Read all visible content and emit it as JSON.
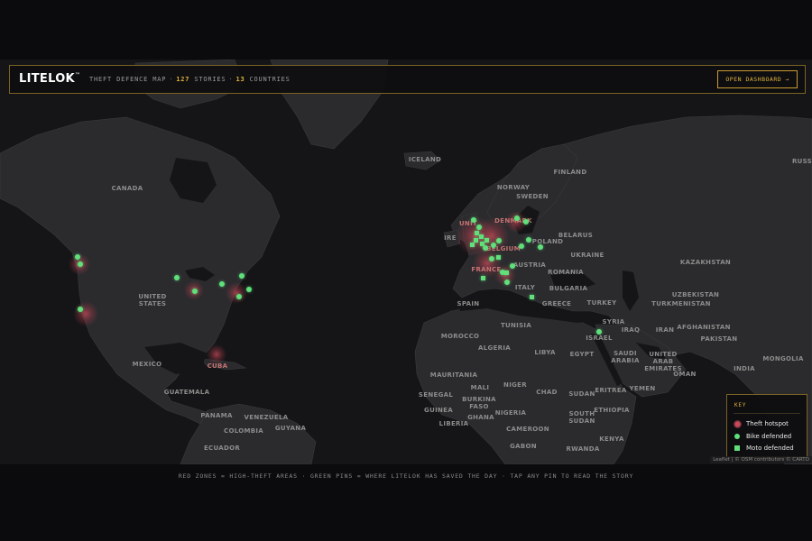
{
  "header": {
    "logo": "LITELOK",
    "logo_mark": "™",
    "subtitle_prefix": "THEFT DEFENCE MAP",
    "stories_count": "127",
    "stories_label": "STORIES",
    "countries_count": "13",
    "countries_label": "COUNTRIES",
    "dashboard_button": "OPEN DASHBOARD →"
  },
  "map": {
    "labels": [
      {
        "id": "iceland",
        "text": "ICELAND"
      },
      {
        "id": "canada",
        "text": "CANADA"
      },
      {
        "id": "usa",
        "text": "UNITED\nSTATES"
      },
      {
        "id": "mexico",
        "text": "MEXICO"
      },
      {
        "id": "cuba",
        "text": "CUBA"
      },
      {
        "id": "guatemala",
        "text": "GUATEMALA"
      },
      {
        "id": "panama",
        "text": "PANAMA"
      },
      {
        "id": "venezuela",
        "text": "VENEZUELA"
      },
      {
        "id": "guyana",
        "text": "GUYANA"
      },
      {
        "id": "colombia",
        "text": "COLOMBIA"
      },
      {
        "id": "ecuador",
        "text": "ECUADOR"
      },
      {
        "id": "finland",
        "text": "FINLAND"
      },
      {
        "id": "norway",
        "text": "NORWAY"
      },
      {
        "id": "sweden",
        "text": "SWEDEN"
      },
      {
        "id": "denmark",
        "text": "DENMARK"
      },
      {
        "id": "belarus",
        "text": "BELARUS"
      },
      {
        "id": "poland",
        "text": "POLAND"
      },
      {
        "id": "ukraine",
        "text": "UKRAINE"
      },
      {
        "id": "austria",
        "text": "AUSTRIA"
      },
      {
        "id": "romania",
        "text": "ROMANIA"
      },
      {
        "id": "bulgaria",
        "text": "BULGARIA"
      },
      {
        "id": "italy",
        "text": "ITALY"
      },
      {
        "id": "greece",
        "text": "GREECE"
      },
      {
        "id": "france",
        "text": "FRANCE"
      },
      {
        "id": "belgium",
        "text": "BELGIUM"
      },
      {
        "id": "ireland",
        "text": "IRE"
      },
      {
        "id": "uk",
        "text": "UNIT"
      },
      {
        "id": "spain",
        "text": "SPAIN"
      },
      {
        "id": "turkey",
        "text": "TURKEY"
      },
      {
        "id": "syria",
        "text": "SYRIA"
      },
      {
        "id": "iraq",
        "text": "IRAQ"
      },
      {
        "id": "iran",
        "text": "IRAN"
      },
      {
        "id": "israel",
        "text": "ISRAEL"
      },
      {
        "id": "tunisia",
        "text": "TUNISIA"
      },
      {
        "id": "morocco",
        "text": "MOROCCO"
      },
      {
        "id": "algeria",
        "text": "ALGERIA"
      },
      {
        "id": "libya",
        "text": "LIBYA"
      },
      {
        "id": "egypt",
        "text": "EGYPT"
      },
      {
        "id": "saudi",
        "text": "SAUDI\nARABIA"
      },
      {
        "id": "uae",
        "text": "UNITED\nARAB\nEMIRATES"
      },
      {
        "id": "oman",
        "text": "OMAN"
      },
      {
        "id": "yemen",
        "text": "YEMEN"
      },
      {
        "id": "eritrea",
        "text": "ERITREA"
      },
      {
        "id": "sudan",
        "text": "SUDAN"
      },
      {
        "id": "ssudan",
        "text": "SOUTH\nSUDAN"
      },
      {
        "id": "ethiopia",
        "text": "ETHIOPIA"
      },
      {
        "id": "kenya",
        "text": "KENYA"
      },
      {
        "id": "chad",
        "text": "CHAD"
      },
      {
        "id": "niger",
        "text": "NIGER"
      },
      {
        "id": "mali",
        "text": "MALI"
      },
      {
        "id": "mauritania",
        "text": "MAURITANIA"
      },
      {
        "id": "senegal",
        "text": "SENEGAL"
      },
      {
        "id": "guinea",
        "text": "GUINEA"
      },
      {
        "id": "burkina",
        "text": "BURKINA\nFASO"
      },
      {
        "id": "liberia",
        "text": "LIBERIA"
      },
      {
        "id": "ghana",
        "text": "GHANA"
      },
      {
        "id": "nigeria",
        "text": "NIGERIA"
      },
      {
        "id": "cameroon",
        "text": "CAMEROON"
      },
      {
        "id": "gabon",
        "text": "GABON"
      },
      {
        "id": "rwanda",
        "text": "RWANDA"
      },
      {
        "id": "kazakhstan",
        "text": "KAZAKHSTAN"
      },
      {
        "id": "uzbekistan",
        "text": "UZBEKISTAN"
      },
      {
        "id": "turkmenistan",
        "text": "TURKMENISTAN"
      },
      {
        "id": "afghanistan",
        "text": "AFGHANISTAN"
      },
      {
        "id": "pakistan",
        "text": "PAKISTAN"
      },
      {
        "id": "india",
        "text": "INDIA"
      },
      {
        "id": "mongolia",
        "text": "MONGOLIA"
      },
      {
        "id": "russ",
        "text": "RUSS"
      }
    ]
  },
  "key": {
    "title": "KEY",
    "theft_hotspot": "Theft hotspot",
    "bike_defended": "Bike defended",
    "moto_defended": "Moto defended"
  },
  "attribution": "Leaflet | © OSM contributors © CARTO",
  "footer": "RED ZONES = HIGH-THEFT AREAS · GREEN PINS = WHERE LITELOK HAS SAVED THE DAY · TAP ANY PIN TO READ THE STORY",
  "colors": {
    "accent": "#e0b23a",
    "pin": "#5fe07a",
    "hotspot": "#c94a5a",
    "land": "#2b2b2e",
    "water": "#151517"
  }
}
